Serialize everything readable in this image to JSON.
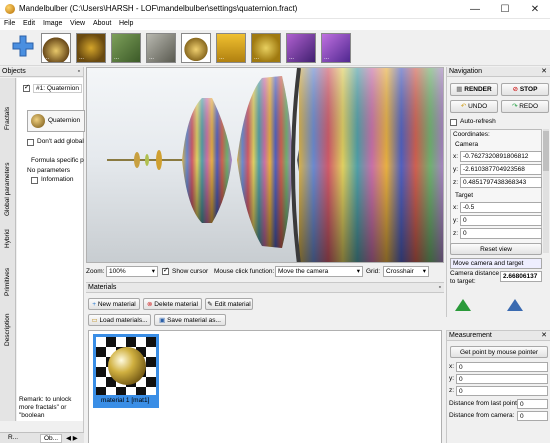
{
  "window": {
    "title": "Mandelbulber (C:\\Users\\HARSH - LOF\\mandelbulber\\settings\\quaternion.fract)",
    "minimize": "—",
    "maximize": "☐",
    "close": "✕"
  },
  "menu": [
    "File",
    "Edit",
    "Image",
    "View",
    "About",
    "Help"
  ],
  "toolbar": {
    "thumb_dots": "..."
  },
  "objects_panel": {
    "title": "Objects",
    "vertical_tabs": [
      "Fractals",
      "Global parameters",
      "Hybrid",
      "Primitives",
      "Description"
    ],
    "fractal_tab_label": "#1: Quaternion",
    "formula_name": "Quaternion",
    "dont_add_label": "Don't add global",
    "formula_specific": "Formula specific p",
    "no_parameters": "No parameters",
    "information_label": "Information",
    "remark": "Remark: to unlock more fractals\" or \"boolean",
    "bottom_tabs": [
      "R...",
      "Ob..."
    ]
  },
  "view_controls": {
    "zoom_label": "Zoom:",
    "zoom_value": "100%",
    "show_cursor_label": "Show cursor",
    "mouse_click_label": "Mouse click function:",
    "mouse_click_value": "Move the camera",
    "grid_label": "Grid:",
    "grid_value": "Crosshair"
  },
  "materials": {
    "title": "Materials",
    "new": "New material",
    "delete": "Delete material",
    "edit": "Edit material",
    "load": "Load materials...",
    "save": "Save material as...",
    "item_label": "material 1 [mat1]"
  },
  "navigation": {
    "title": "Navigation",
    "render": "RENDER",
    "stop": "STOP",
    "undo": "UNDO",
    "redo": "REDO",
    "auto_refresh": "Auto-refresh",
    "coordinates": "Coordinates:",
    "camera": "Camera",
    "cam_x": "-0.7627320891806812",
    "cam_y": "-2.610387704923568",
    "cam_z": "0.4851797438368343",
    "target": "Target",
    "tgt_x": "-0.5",
    "tgt_y": "0",
    "tgt_z": "0",
    "reset_view": "Reset view",
    "move_mode": "Move camera and target",
    "camera_distance_label": "Camera distance to target:",
    "camera_distance_value": "2.66806137"
  },
  "measurement": {
    "title": "Measurement",
    "get_point": "Get point by mouse pointer",
    "x": "0",
    "y": "0",
    "z": "0",
    "from_last_label": "Distance from last point:",
    "from_last_value": "0",
    "from_camera_label": "Distance from camera:",
    "from_camera_value": "0"
  },
  "axis_labels": {
    "x": "x:",
    "y": "y:",
    "z": "z:"
  }
}
